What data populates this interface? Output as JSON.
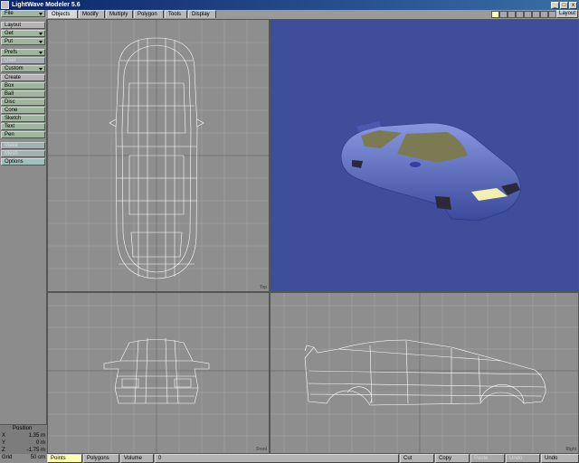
{
  "window": {
    "title": "LightWave Modeler 5.6",
    "btn_min": "_",
    "btn_max": "□",
    "btn_close": "x"
  },
  "tabs": [
    "Objects",
    "Modify",
    "Multiply",
    "Polygon",
    "Tools",
    "Display"
  ],
  "layout_button": "Layout",
  "layers": [
    "",
    "",
    "",
    "",
    "",
    "",
    "",
    "",
    "",
    ""
  ],
  "sidebar": {
    "file": "File",
    "layout_head": "Layout",
    "get": "Get",
    "put": "Put",
    "prefs": "Prefs",
    "user_dim": "User",
    "custom": "Custom",
    "create_head": "Create",
    "create_items": [
      "Box",
      "Ball",
      "Disc",
      "Cone",
      "Sketch",
      "Text",
      "Pen"
    ],
    "dim_items": [
      "Make",
      "Mesh"
    ],
    "options": "Options"
  },
  "position": {
    "title": "Position",
    "x_label": "X",
    "x_value": "1.35 m",
    "y_label": "Y",
    "y_value": "0 m",
    "z_label": "Z",
    "z_value": "-1.75 m"
  },
  "grid": {
    "label": "Grid",
    "value": "50 cm"
  },
  "viewports": {
    "top_label": "Top",
    "front_label": "Front",
    "side_label": "Right"
  },
  "bottombar": {
    "points": "Points",
    "polygons": "Polygons",
    "volume": "Volume",
    "count": "0",
    "cut": "Cut",
    "copy": "Copy",
    "paste": "Paste",
    "undo_dim": "Undo",
    "undo": "Undo"
  },
  "colors": {
    "perspective_bg": "#3e4e9a",
    "car_body": "#5a6cc0",
    "wire": "#ffffff",
    "viewport_bg": "#8e8e8e"
  }
}
